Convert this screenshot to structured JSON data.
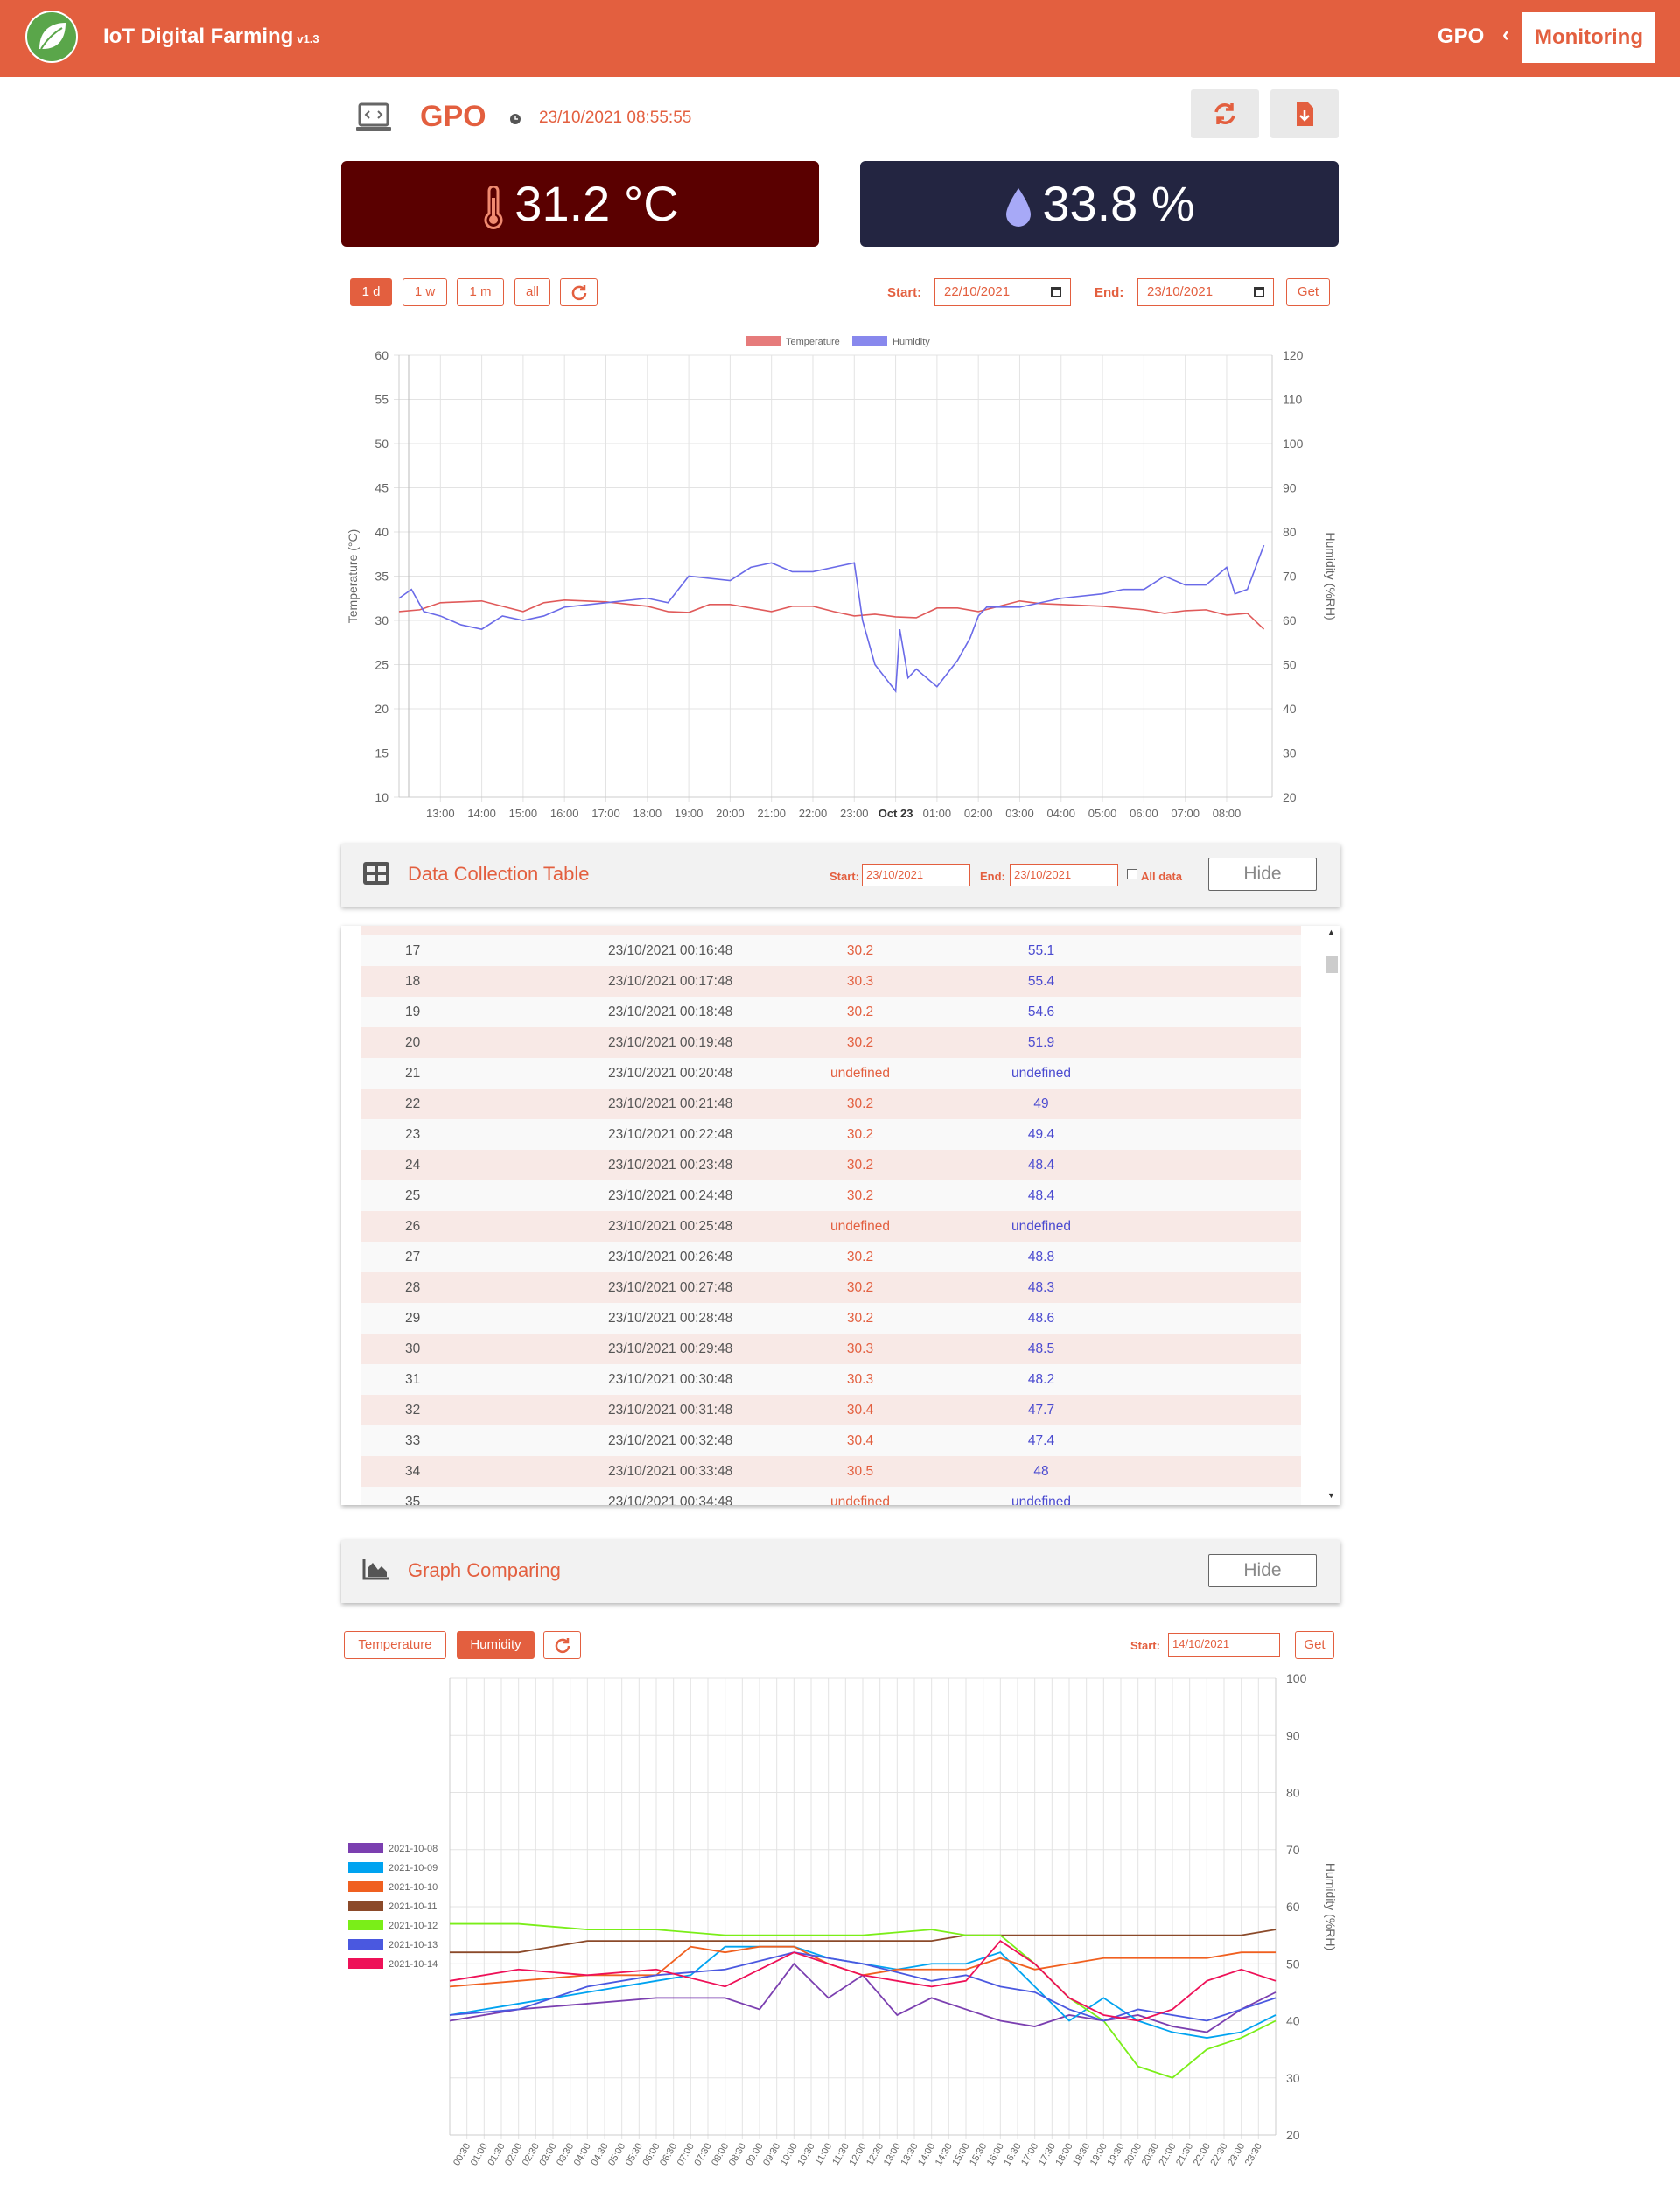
{
  "header": {
    "app_title": "IoT Digital Farming",
    "app_version": "v1.3",
    "breadcrumb_device": "GPO",
    "breadcrumb_current": "Monitoring"
  },
  "device": {
    "name": "GPO",
    "timestamp": "23/10/2021 08:55:55",
    "refresh_icon": "refresh-icon",
    "export_icon": "file-download-icon"
  },
  "readings": {
    "temperature": "31.2 °C",
    "humidity": "33.8 %",
    "temp_color": "#5a0000",
    "hum_color": "#232541"
  },
  "range_controls": {
    "buttons": [
      "1 d",
      "1 w",
      "1 m",
      "all"
    ],
    "active": "1 d",
    "start_label": "Start:",
    "start_value": "22/10/2021",
    "end_label": "End:",
    "end_value": "23/10/2021",
    "get_label": "Get"
  },
  "table_panel": {
    "title": "Data Collection Table",
    "start_label": "Start:",
    "start_value": "23/10/2021",
    "end_label": "End:",
    "end_value": "23/10/2021",
    "all_data_label": "All data",
    "hide_label": "Hide",
    "rows": [
      [
        "17",
        "23/10/2021 00:16:48",
        "30.2",
        "55.1"
      ],
      [
        "18",
        "23/10/2021 00:17:48",
        "30.3",
        "55.4"
      ],
      [
        "19",
        "23/10/2021 00:18:48",
        "30.2",
        "54.6"
      ],
      [
        "20",
        "23/10/2021 00:19:48",
        "30.2",
        "51.9"
      ],
      [
        "21",
        "23/10/2021 00:20:48",
        "undefined",
        "undefined"
      ],
      [
        "22",
        "23/10/2021 00:21:48",
        "30.2",
        "49"
      ],
      [
        "23",
        "23/10/2021 00:22:48",
        "30.2",
        "49.4"
      ],
      [
        "24",
        "23/10/2021 00:23:48",
        "30.2",
        "48.4"
      ],
      [
        "25",
        "23/10/2021 00:24:48",
        "30.2",
        "48.4"
      ],
      [
        "26",
        "23/10/2021 00:25:48",
        "undefined",
        "undefined"
      ],
      [
        "27",
        "23/10/2021 00:26:48",
        "30.2",
        "48.8"
      ],
      [
        "28",
        "23/10/2021 00:27:48",
        "30.2",
        "48.3"
      ],
      [
        "29",
        "23/10/2021 00:28:48",
        "30.2",
        "48.6"
      ],
      [
        "30",
        "23/10/2021 00:29:48",
        "30.3",
        "48.5"
      ],
      [
        "31",
        "23/10/2021 00:30:48",
        "30.3",
        "48.2"
      ],
      [
        "32",
        "23/10/2021 00:31:48",
        "30.4",
        "47.7"
      ],
      [
        "33",
        "23/10/2021 00:32:48",
        "30.4",
        "47.4"
      ],
      [
        "34",
        "23/10/2021 00:33:48",
        "30.5",
        "48"
      ],
      [
        "35",
        "23/10/2021 00:34:48",
        "undefined",
        "undefined"
      ]
    ]
  },
  "compare_panel": {
    "title": "Graph Comparing",
    "hide_label": "Hide",
    "buttons": [
      "Temperature",
      "Humidity"
    ],
    "active": "Humidity",
    "start_label": "Start:",
    "start_value": "14/10/2021",
    "get_label": "Get"
  },
  "chart_data": [
    {
      "type": "line",
      "legend": [
        "Temperature",
        "Humidity"
      ],
      "legend_position": "top-center",
      "xlabel": "",
      "ylabel_left": "Temperature (°C)",
      "ylabel_right": "Humidity (%RH)",
      "ylim_left": [
        10,
        60
      ],
      "ylim_right": [
        20,
        120
      ],
      "yticks_left": [
        "10",
        "15",
        "20",
        "25",
        "30",
        "35",
        "40",
        "45",
        "50",
        "55",
        "60"
      ],
      "yticks_right": [
        "20",
        "30",
        "40",
        "50",
        "60",
        "70",
        "80",
        "90",
        "100",
        "110",
        "120"
      ],
      "x_ticks": [
        "13:00",
        "14:00",
        "15:00",
        "16:00",
        "17:00",
        "18:00",
        "19:00",
        "20:00",
        "21:00",
        "22:00",
        "23:00",
        "Oct 23",
        "01:00",
        "02:00",
        "03:00",
        "04:00",
        "05:00",
        "06:00",
        "07:00",
        "08:00"
      ],
      "grid": true,
      "series": [
        {
          "name": "Temperature",
          "color": "#e05a5a",
          "x": [
            12.0,
            12.5,
            13.0,
            13.5,
            14.0,
            14.5,
            15.0,
            15.5,
            16.0,
            17.0,
            18.0,
            18.5,
            19.0,
            19.5,
            20.0,
            21.0,
            21.5,
            22.0,
            22.5,
            23.0,
            23.5,
            24.0,
            24.5,
            25.0,
            25.5,
            26.0,
            27.0,
            27.5,
            28.0,
            29.0,
            30.0,
            30.5,
            31.0,
            31.5,
            32.0,
            32.5,
            32.9
          ],
          "y": [
            31.0,
            31.2,
            32.0,
            32.1,
            32.2,
            31.6,
            31.0,
            32.0,
            32.3,
            32.1,
            31.6,
            31.0,
            30.9,
            31.8,
            31.8,
            31.0,
            31.6,
            31.6,
            31.0,
            30.5,
            30.7,
            30.4,
            30.3,
            31.4,
            31.4,
            31.0,
            32.2,
            31.9,
            31.8,
            31.6,
            31.2,
            30.8,
            31.1,
            31.2,
            30.6,
            30.8,
            29.0
          ]
        },
        {
          "name": "Humidity",
          "color": "#6a6ae8",
          "x": [
            12.0,
            12.3,
            12.6,
            13.0,
            13.5,
            14.0,
            14.5,
            15.0,
            15.5,
            16.0,
            17.0,
            18.0,
            18.5,
            19.0,
            20.0,
            20.5,
            21.0,
            21.5,
            22.0,
            22.5,
            23.0,
            23.2,
            23.5,
            24.0,
            24.1,
            24.3,
            24.5,
            25.0,
            25.5,
            25.8,
            26.0,
            26.2,
            26.5,
            27.0,
            28.0,
            29.0,
            29.5,
            30.0,
            30.5,
            31.0,
            31.5,
            32.0,
            32.2,
            32.5,
            32.9
          ],
          "y": [
            65,
            67,
            62,
            61,
            59,
            58,
            61,
            60,
            61,
            63,
            64,
            65,
            64,
            70,
            69,
            72,
            73,
            71,
            71,
            72,
            73,
            60,
            50,
            44,
            58,
            47,
            49,
            45,
            51,
            56,
            61,
            63,
            63,
            63,
            65,
            66,
            67,
            67,
            70,
            68,
            68,
            72,
            66,
            67,
            77
          ]
        }
      ]
    },
    {
      "type": "line",
      "legend": [
        "2021-10-08",
        "2021-10-09",
        "2021-10-10",
        "2021-10-11",
        "2021-10-12",
        "2021-10-13",
        "2021-10-14"
      ],
      "legend_position": "left",
      "xlabel": "",
      "ylabel": "Humidity (%RH)",
      "ylim": [
        20,
        100
      ],
      "yticks": [
        "20",
        "30",
        "40",
        "50",
        "60",
        "70",
        "80",
        "90",
        "100"
      ],
      "x_ticks": [
        "00:30",
        "01:00",
        "01:30",
        "02:00",
        "02:30",
        "03:00",
        "03:30",
        "04:00",
        "04:30",
        "05:00",
        "05:30",
        "06:00",
        "06:30",
        "07:00",
        "07:30",
        "08:00",
        "08:30",
        "09:00",
        "09:30",
        "10:00",
        "10:30",
        "11:00",
        "11:30",
        "12:00",
        "12:30",
        "13:00",
        "13:30",
        "14:00",
        "14:30",
        "15:00",
        "15:30",
        "16:00",
        "16:30",
        "17:00",
        "17:30",
        "18:00",
        "18:30",
        "19:00",
        "19:30",
        "20:00",
        "20:30",
        "21:00",
        "21:30",
        "22:00",
        "22:30",
        "23:00",
        "23:30"
      ],
      "grid": true,
      "series": [
        {
          "name": "2021-10-08",
          "color": "#7b3fb0",
          "x": [
            0,
            2,
            4,
            6,
            8,
            9,
            10,
            11,
            12,
            13,
            14,
            15,
            16,
            17,
            18,
            19,
            20,
            21,
            22,
            23,
            24
          ],
          "y": [
            40,
            42,
            43,
            44,
            44,
            42,
            50,
            44,
            48,
            41,
            44,
            42,
            40,
            39,
            41,
            40,
            41,
            39,
            38,
            42,
            45
          ]
        },
        {
          "name": "2021-10-09",
          "color": "#00a3f0",
          "x": [
            0,
            2,
            4,
            6,
            7,
            8,
            9,
            10,
            11,
            12,
            13,
            14,
            15,
            16,
            17,
            18,
            19,
            20,
            21,
            22,
            23,
            24
          ],
          "y": [
            41,
            43,
            45,
            47,
            48,
            53,
            53,
            53,
            51,
            50,
            49,
            50,
            50,
            52,
            46,
            40,
            44,
            40,
            38,
            37,
            38,
            41
          ]
        },
        {
          "name": "2021-10-10",
          "color": "#f06020",
          "x": [
            0,
            2,
            4,
            6,
            7,
            8,
            9,
            10,
            11,
            12,
            13,
            14,
            15,
            16,
            17,
            18,
            19,
            20,
            21,
            22,
            23,
            24
          ],
          "y": [
            46,
            47,
            48,
            48,
            53,
            52,
            53,
            53,
            50,
            48,
            49,
            49,
            49,
            51,
            49,
            50,
            51,
            51,
            51,
            51,
            52,
            52
          ]
        },
        {
          "name": "2021-10-11",
          "color": "#8b4a2a",
          "x": [
            0,
            2,
            4,
            6,
            8,
            10,
            12,
            14,
            15,
            16,
            17,
            18,
            19,
            20,
            21,
            22,
            23,
            24
          ],
          "y": [
            52,
            52,
            54,
            54,
            54,
            54,
            54,
            54,
            55,
            55,
            55,
            55,
            55,
            55,
            55,
            55,
            55,
            56
          ]
        },
        {
          "name": "2021-10-12",
          "color": "#7aee18",
          "x": [
            0,
            2,
            4,
            6,
            8,
            10,
            12,
            14,
            15,
            16,
            17,
            18,
            19,
            20,
            21,
            22,
            23,
            24
          ],
          "y": [
            57,
            57,
            56,
            56,
            55,
            55,
            55,
            56,
            55,
            55,
            50,
            44,
            40,
            32,
            30,
            35,
            37,
            40
          ]
        },
        {
          "name": "2021-10-13",
          "color": "#4a58e0",
          "x": [
            0,
            2,
            4,
            6,
            8,
            10,
            12,
            14,
            15,
            16,
            17,
            18,
            19,
            20,
            21,
            22,
            23,
            24
          ],
          "y": [
            41,
            42,
            46,
            48,
            49,
            52,
            50,
            47,
            48,
            46,
            45,
            42,
            40,
            42,
            41,
            40,
            42,
            44
          ]
        },
        {
          "name": "2021-10-14",
          "color": "#ee1158",
          "x": [
            0,
            2,
            4,
            6,
            8,
            10,
            12,
            14,
            15,
            16,
            17,
            18,
            19,
            20,
            21,
            22,
            23,
            24
          ],
          "y": [
            47,
            49,
            48,
            49,
            46,
            52,
            48,
            46,
            47,
            54,
            50,
            44,
            41,
            40,
            42,
            47,
            49,
            47
          ]
        }
      ]
    }
  ]
}
